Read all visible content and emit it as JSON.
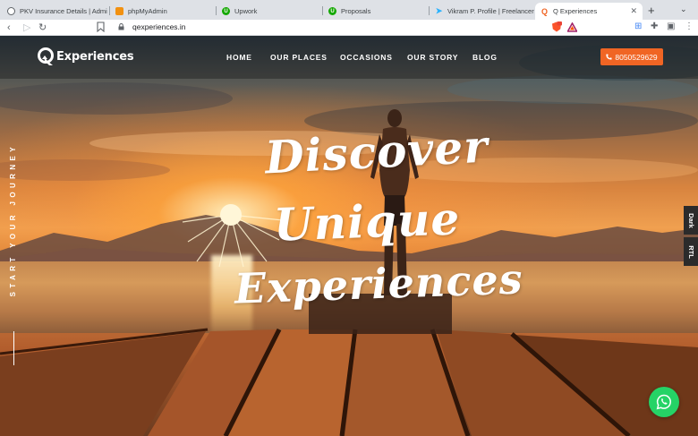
{
  "browser": {
    "tabs": [
      {
        "title": "PKV Insurance Details | Admin",
        "icon": "globe-icon",
        "color": "#5f6368"
      },
      {
        "title": "phpMyAdmin",
        "icon": "phpmyadmin-icon",
        "color": "#f29111"
      },
      {
        "title": "Upwork",
        "icon": "upwork-icon",
        "color": "#14a800"
      },
      {
        "title": "Proposals",
        "icon": "upwork-icon",
        "color": "#14a800"
      },
      {
        "title": "Vikram P. Profile | Freelancer",
        "icon": "freelancer-icon",
        "color": "#29b2fe"
      },
      {
        "title": "Q Experiences",
        "icon": "q-icon",
        "color": "#f06524",
        "active": true
      }
    ],
    "url": "qexperiences.in",
    "new_tab_symbol": "+"
  },
  "site": {
    "logo_text": "Experiences",
    "nav": [
      "HOME",
      "OUR PLACES",
      "OCCASIONS",
      "OUR STORY",
      "BLOG"
    ],
    "phone": "8050529629",
    "hero": [
      "Discover",
      "Unique",
      "Experiences"
    ],
    "side_text": "START YOUR JOURNEY",
    "side_tabs": [
      "Dark",
      "RTL"
    ],
    "accent_color": "#f06524",
    "whatsapp_color": "#25d366"
  }
}
